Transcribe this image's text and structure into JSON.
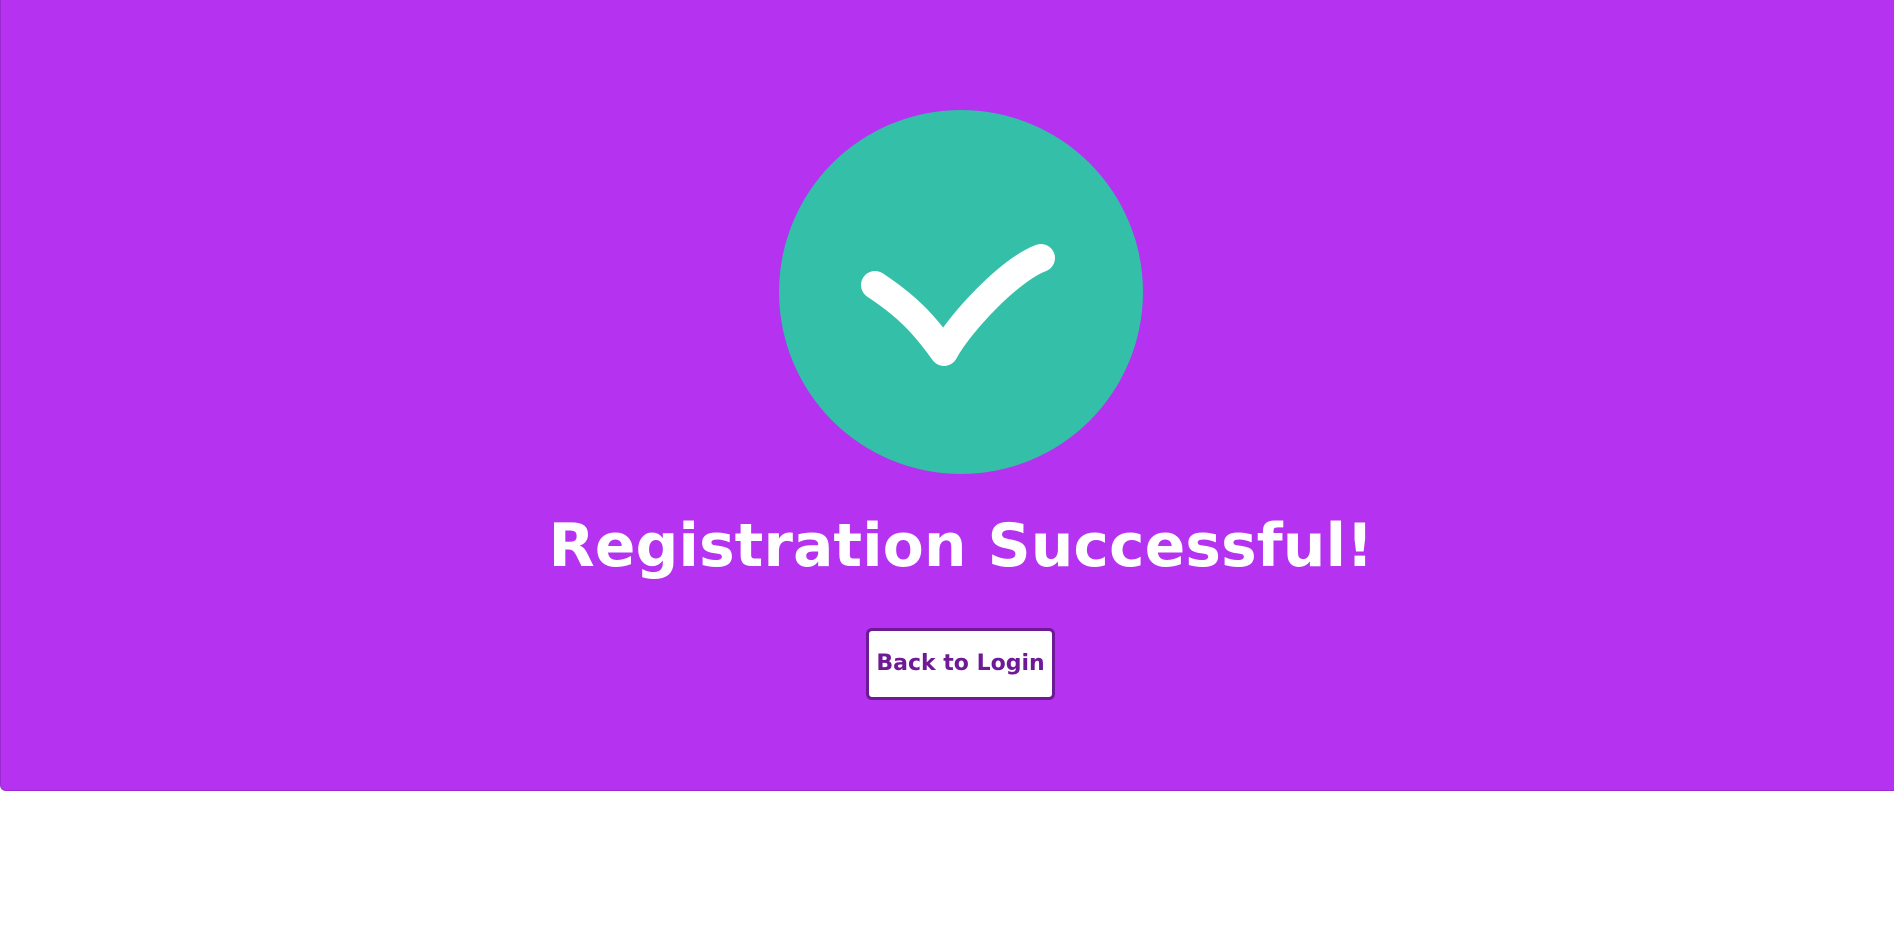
{
  "page": {
    "title": "Registration Successful!"
  },
  "actions": {
    "back_label": "Back to Login"
  },
  "icons": {
    "status": "checkmark-icon"
  },
  "colors": {
    "panel_background": "#b432f0",
    "success_circle": "#33bfa8",
    "button_text": "#6e1a96",
    "text": "#ffffff"
  }
}
